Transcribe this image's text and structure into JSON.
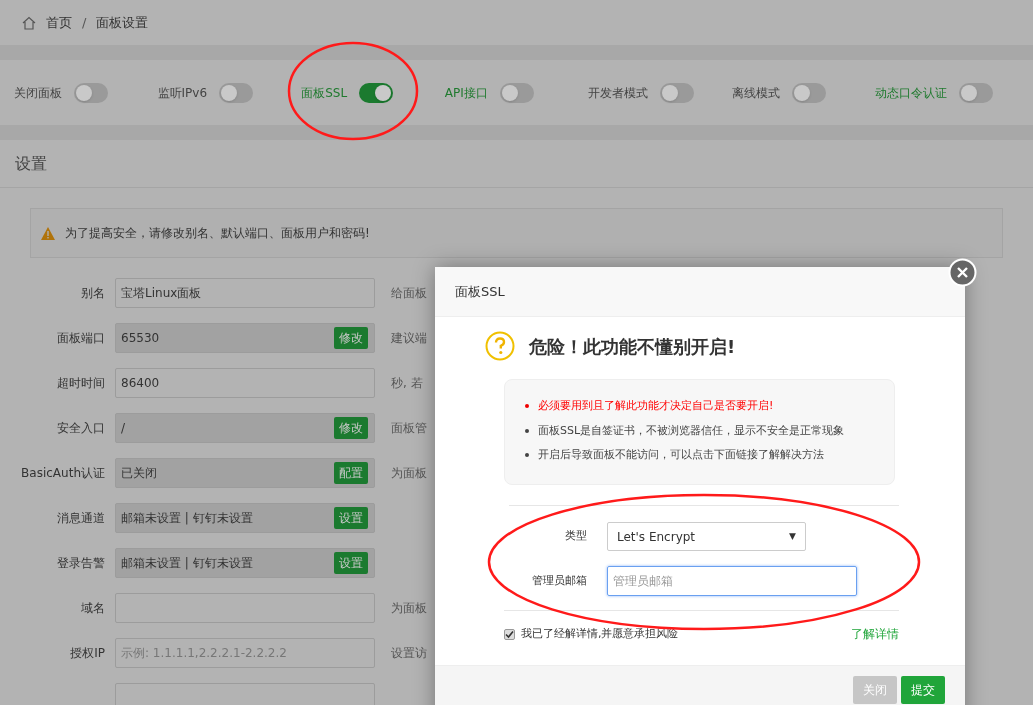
{
  "breadcrumb": [
    {
      "label": "首页"
    },
    {
      "label": "面板设置"
    }
  ],
  "breadcrumb_separator": "/",
  "toggles": [
    {
      "label": "关闭面板",
      "on": false,
      "link": false
    },
    {
      "label": "监听IPv6",
      "on": false,
      "link": false
    },
    {
      "label": "面板SSL",
      "on": true,
      "link": true
    },
    {
      "label": "API接口",
      "on": false,
      "link": true
    },
    {
      "label": "开发者模式",
      "on": false,
      "link": false
    },
    {
      "label": "离线模式",
      "on": false,
      "link": false
    },
    {
      "label": "动态口令认证",
      "on": false,
      "link": true
    }
  ],
  "settings": {
    "title": "设置",
    "alert": "为了提高安全，请修改别名、默认端口、面板用户和密码!",
    "rows": [
      {
        "label": "别名",
        "value": "宝塔Linux面板",
        "readonly": false,
        "hint": "给面板"
      },
      {
        "label": "面板端口",
        "value": "65530",
        "readonly": true,
        "button": "修改",
        "hint": "建议端"
      },
      {
        "label": "超时时间",
        "value": "86400",
        "readonly": false,
        "hint": "秒, 若"
      },
      {
        "label": "安全入口",
        "value": "/",
        "readonly": true,
        "button": "修改",
        "hint": "面板管"
      },
      {
        "label": "BasicAuth认证",
        "value": "已关闭",
        "readonly": true,
        "button": "配置",
        "hint": "为面板"
      },
      {
        "label": "消息通道",
        "value": "邮箱未设置 | 钉钉未设置",
        "readonly": true,
        "button": "设置"
      },
      {
        "label": "登录告警",
        "value": "邮箱未设置 | 钉钉未设置",
        "readonly": true,
        "button": "设置"
      },
      {
        "label": "域名",
        "readonly": false,
        "hint": "为面板"
      },
      {
        "label": "授权IP",
        "placeholder": "示例: 1.1.1.1,2.2.2.1-2.2.2.2",
        "readonly": false,
        "hint": "设置访"
      }
    ]
  },
  "dialog": {
    "title": "面板SSL",
    "heading": "危险！此功能不懂别开启!",
    "notes": [
      {
        "text": "必须要用到且了解此功能才决定自己是否要开启!",
        "warning": true
      },
      {
        "text": "面板SSL是自签证书，不被浏览器信任，显示不安全是正常现象",
        "warning": false
      },
      {
        "text": "开启后导致面板不能访问，可以点击下面链接了解解决方法",
        "warning": false
      }
    ],
    "type_label": "类型",
    "type_value": "Let's Encrypt",
    "type_caret": "▼",
    "email_label": "管理员邮箱",
    "email_placeholder": "管理员邮箱",
    "email_focused": true,
    "agree": {
      "label": "我已了经解详情,并愿意承担风险",
      "checked": true
    },
    "details_link": "了解详情",
    "buttons": [
      {
        "label": "关闭",
        "kind": "secondary"
      },
      {
        "label": "提交",
        "kind": "primary"
      }
    ]
  }
}
